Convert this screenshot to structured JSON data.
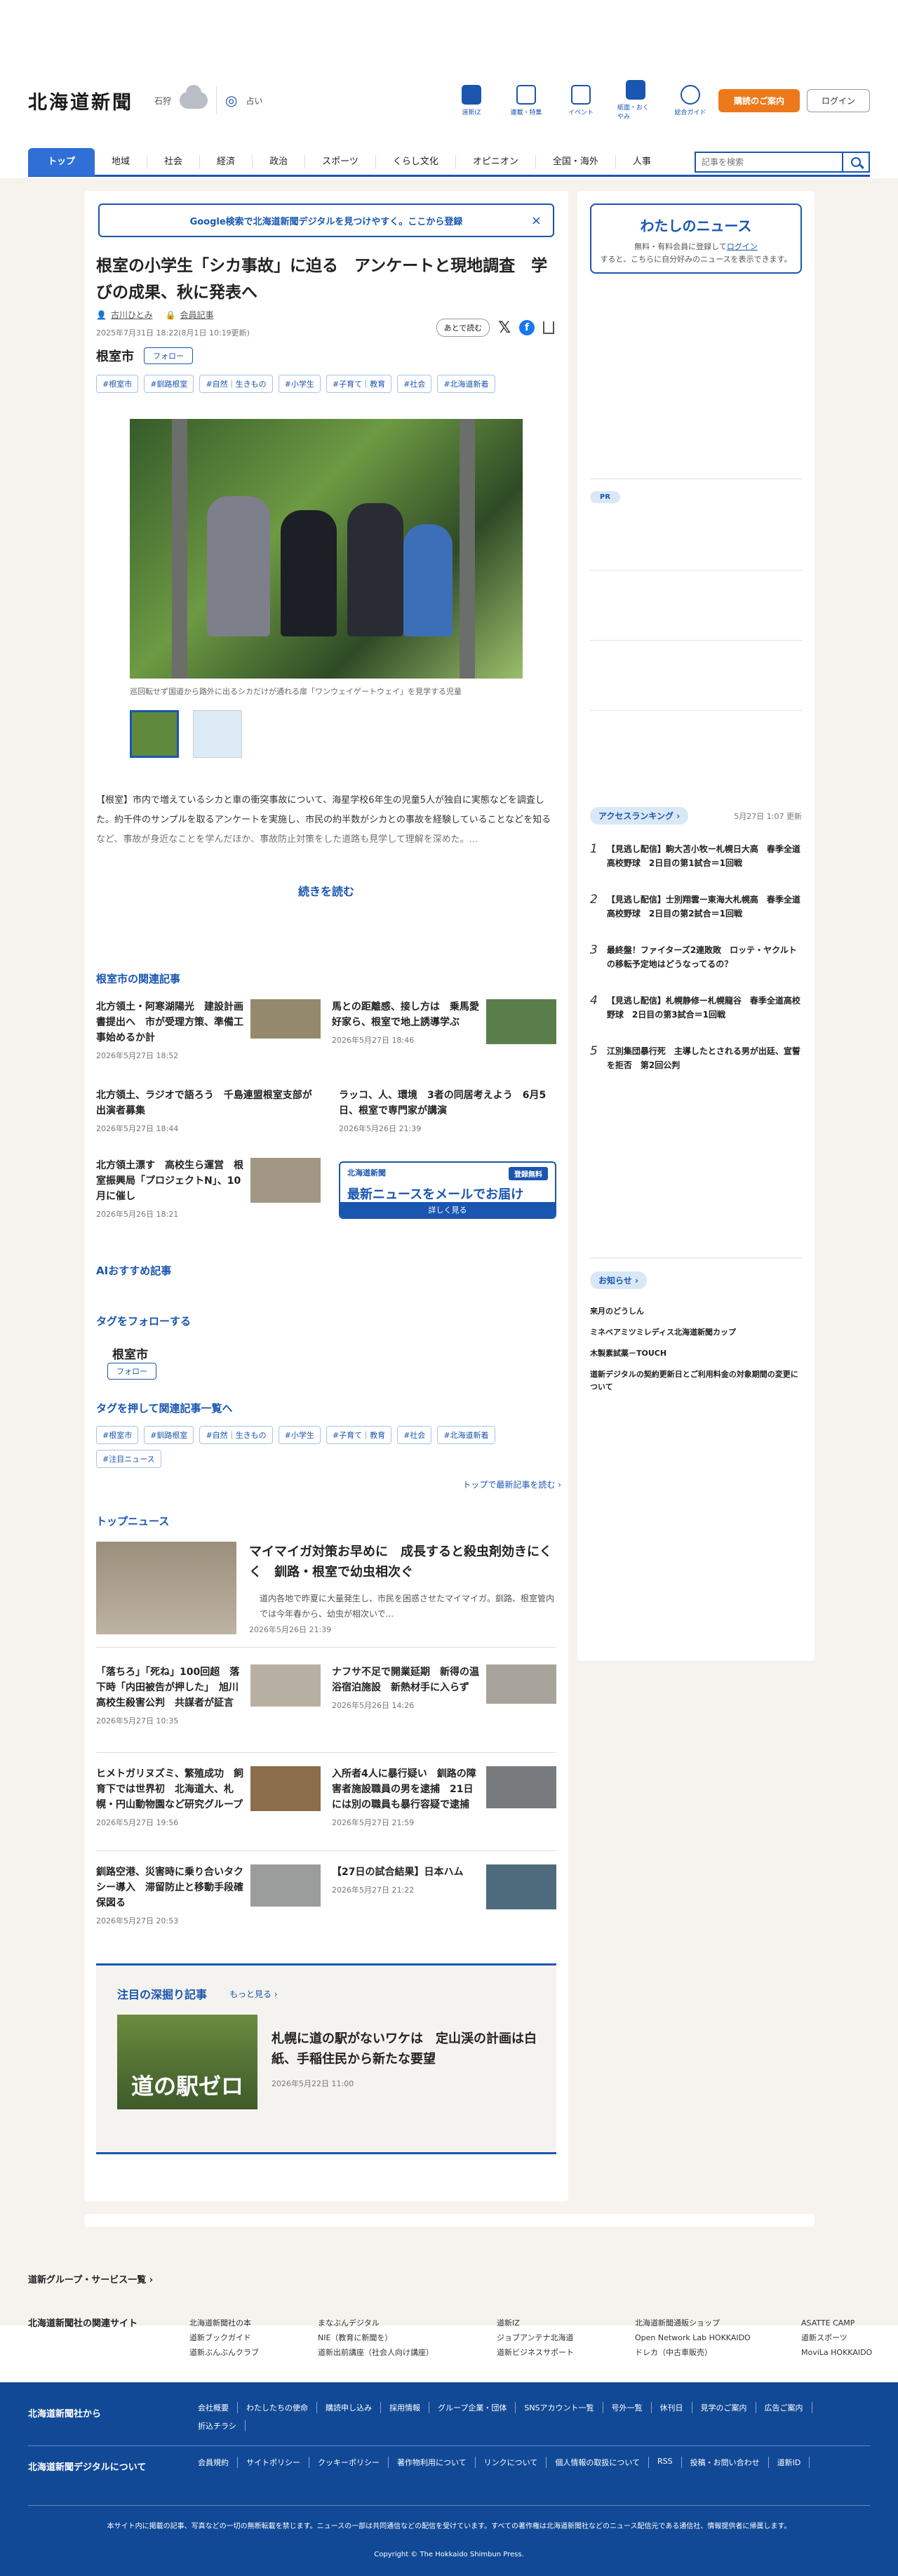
{
  "header": {
    "logo": "北海道新聞",
    "location": "石狩",
    "settings_label": "占い",
    "icons": [
      {
        "icon": "paper-icon",
        "label": "道新IZ"
      },
      {
        "icon": "flag-icon",
        "label": "連載・特集"
      },
      {
        "icon": "calendar-icon",
        "label": "イベント"
      },
      {
        "icon": "newspaper-icon",
        "label": "紙面・おくやみ"
      },
      {
        "icon": "help-icon",
        "label": "総合ガイド"
      }
    ],
    "subscribe": "購読のご案内",
    "login": "ログイン"
  },
  "nav": {
    "items": [
      "トップ",
      "地域",
      "社会",
      "経済",
      "政治",
      "スポーツ",
      "くらし文化",
      "オピニオン",
      "全国・海外",
      "人事"
    ],
    "search_placeholder": "記事を検索"
  },
  "article": {
    "banner": "Google検索で北海道新聞デジタルを見つけやすく。ここから登録",
    "title": "根室の小学生「シカ事故」に迫る　アンケートと現地調査　学びの成果、秋に発表へ",
    "author": "古川ひとみ",
    "member_label": "会員記事",
    "date": "2025年7月31日 18:22(8月1日 10:19更新)",
    "later": "あとで読む",
    "location": "根室市",
    "follow": "フォロー",
    "tags": [
      "#根室市",
      "#釧路根室",
      "#自然｜生きもの",
      "#小学生",
      "#子育て｜教育",
      "#社会",
      "#北海道新着"
    ],
    "caption": "巡回転せず国道から路外に出るシカだけが通れる扉「ワンウェイゲートウェイ」を見学する児童",
    "lead": "【根室】市内で増えているシカと車の衝突事故について、海星学校6年生の児童5人が独自に実態などを調査した。約千件のサンプルを取るアンケートを実施し、市民の約半数がシカとの事故を経験していることなどを知るなど、事故が身近なことを学んだほか、事故防止対策をした道路も見学して理解を深めた。...",
    "read_more": "続きを読む"
  },
  "related": {
    "heading": "根室市の関連記事",
    "items": [
      {
        "title": "北方領土・阿寒湖陽光　建設計画書提出へ　市が受理方策、準備工事始めるか計",
        "date": "2026年5月27日 18:52"
      },
      {
        "title": "馬との距離感、接し方は　乗馬愛好家ら、根室で地上誘導学ぶ",
        "date": "2026年5月27日 18:46"
      },
      {
        "title": "北方領土、ラジオで語ろう　千島連盟根室支部が出演者募集",
        "date": "2026年5月27日 18:44"
      },
      {
        "title": "ラッコ、人、環境　3者の同居考えよう　6月5日、根室で専門家が講演",
        "date": "2026年5月26日 21:39"
      },
      {
        "title": "北方領土漂す　高校生ら運営　根室振興局「プロジェクトN」、10月に催し",
        "date": "2026年5月26日 18:21"
      }
    ],
    "mail": {
      "brand": "北海道新聞",
      "register": "登録無料",
      "headline": "最新ニュースをメールでお届け",
      "cta": "詳しく見る"
    }
  },
  "ai": {
    "heading": "AIおすすめ記事"
  },
  "tag_follow": {
    "heading": "タグをフォローする",
    "location": "根室市",
    "follow": "フォロー"
  },
  "tag_list": {
    "heading": "タグを押して関連記事一覧へ",
    "tags": [
      "#根室市",
      "#釧路根室",
      "#自然｜生きもの",
      "#小学生",
      "#子育て｜教育",
      "#社会",
      "#北海道新着",
      "#注目ニュース"
    ],
    "more": "トップで最新記事を読む"
  },
  "top_news": {
    "heading": "トップニュース",
    "hero": {
      "title": "マイマイガ対策お早めに　成長すると殺虫剤効きにくく　釧路・根室で幼虫相次ぐ",
      "summary": "道内各地で昨夏に大量発生し、市民を困惑させたマイマイガ。釧路、根室管内では今年春から、幼虫が相次いで...",
      "date": "2026年5月26日 21:39"
    },
    "items": [
      {
        "title": "「落ちろ」「死ね」100回超　落下時「内田被告が押した」　旭川高校生殺害公判　共謀者が証言",
        "date": "2026年5月27日 10:35"
      },
      {
        "title": "ナフサ不足で開業延期　新得の温浴宿泊施設　新熱材手に入らず",
        "date": "2026年5月26日 14:26"
      },
      {
        "title": "ヒメトガリヌズミ、繁殖成功　飼育下では世界初　北海道大、札幌・円山動物園など研究グループ",
        "date": "2026年5月27日 19:56"
      },
      {
        "title": "入所者4人に暴行疑い　釧路の障害者施設職員の男を逮捕　21日には別の職員も暴行容疑で逮捕",
        "date": "2026年5月27日 21:59"
      },
      {
        "title": "釧路空港、災害時に乗り合いタクシー導入　滞留防止と移動手段確保図る",
        "date": "2026年5月27日 20:53"
      },
      {
        "title": "【27日の試合結果】日本ハム",
        "date": "2026年5月27日 21:22"
      }
    ]
  },
  "deep": {
    "heading": "注目の深掘り記事",
    "more": "もっと見る",
    "image_text": "道の駅ゼロ",
    "title": "札幌に道の駅がないワケは　定山渓の計画は白紙、手稲住民から新たな要望",
    "date": "2026年5月22日 11:00"
  },
  "sidebar": {
    "mynews": {
      "title": "わたしのニュース",
      "text_a": "無料・有料会員に登録して",
      "login": "ログイン",
      "text_b": "すると、こちらに自分好みのニュースを表示できます。"
    },
    "pr": "PR",
    "ranking": {
      "heading": "アクセスランキング",
      "date": "5月27日 1:07 更新",
      "items": [
        "【見逃し配信】駒大苫小牧ー札幌日大高　春季全道高校野球　2日目の第1試合＝1回戦",
        "【見逃し配信】士別翔雲ー東海大札幌高　春季全道高校野球　2日目の第2試合＝1回戦",
        "最終盤！ファイターズ2連敗敗　ロッテ・ヤクルトの移転予定地はどうなってるの？",
        "【見逃し配信】札幌静修ー札幌龍谷　春季全道高校野球　2日目の第3試合＝1回戦",
        "江別集団暴行死　主導したとされる男が出廷、宣誓を拒否　第2回公判"
      ]
    },
    "notice": {
      "heading": "お知らせ",
      "items": [
        "来月のどうしん",
        "ミネベアミツミレディス北海道新聞カップ",
        "木製素試薬－TOUCH",
        "道新デジタルの契約更新日とご利用料金の対象期間の変更について"
      ]
    }
  },
  "footer": {
    "group": "道新グループ・サービス一覧",
    "related_sites": "北海道新聞社の関連サイト",
    "cols": [
      [
        "北海道新聞社の本",
        "道新ブックガイド",
        "道新ぶんぶんクラブ"
      ],
      [
        "まなぶんデジタル",
        "わたしたちの使命",
        "NIE（教育に新聞を）",
        "道新出前講座（社会人向け講座）"
      ],
      [
        "道新IZ",
        "ジョブアンテナ北海道",
        "道新ビジネスサポート"
      ],
      [
        "北海道新聞通販ショップ",
        "Open Network Lab HOKKAIDO",
        "ドレカ（中古車販売）"
      ],
      [
        "ASATTE CAMP",
        "道新スポーツ",
        "MoviLa HOKKAIDO"
      ]
    ],
    "company_heading": "北海道新聞社から",
    "company_links": [
      "会社概要",
      "わたしたちの使命",
      "購読申し込み",
      "採用情報",
      "グループ企業・団体",
      "SNSアカウント一覧",
      "号外一覧",
      "休刊日",
      "見学のご案内",
      "広告ご案内",
      "折込チラシ"
    ],
    "digital_heading": "北海道新聞デジタルについて",
    "digital_links": [
      "会員規約",
      "サイトポリシー",
      "クッキーポリシー",
      "著作物利用について",
      "リンクについて",
      "個人情報の取扱について",
      "RSS",
      "投稿・お問い合わせ",
      "道新ID"
    ],
    "note": "本サイト内に掲載の記事、写真などの一切の無断転載を禁じます。ニュースの一部は共同通信などの配信を受けています。すべての著作権は北海道新聞社などのニュース配信元である通信社、情報提供者に帰属します。",
    "copyright": "Copyright © The Hokkaido Shimbun Press."
  }
}
